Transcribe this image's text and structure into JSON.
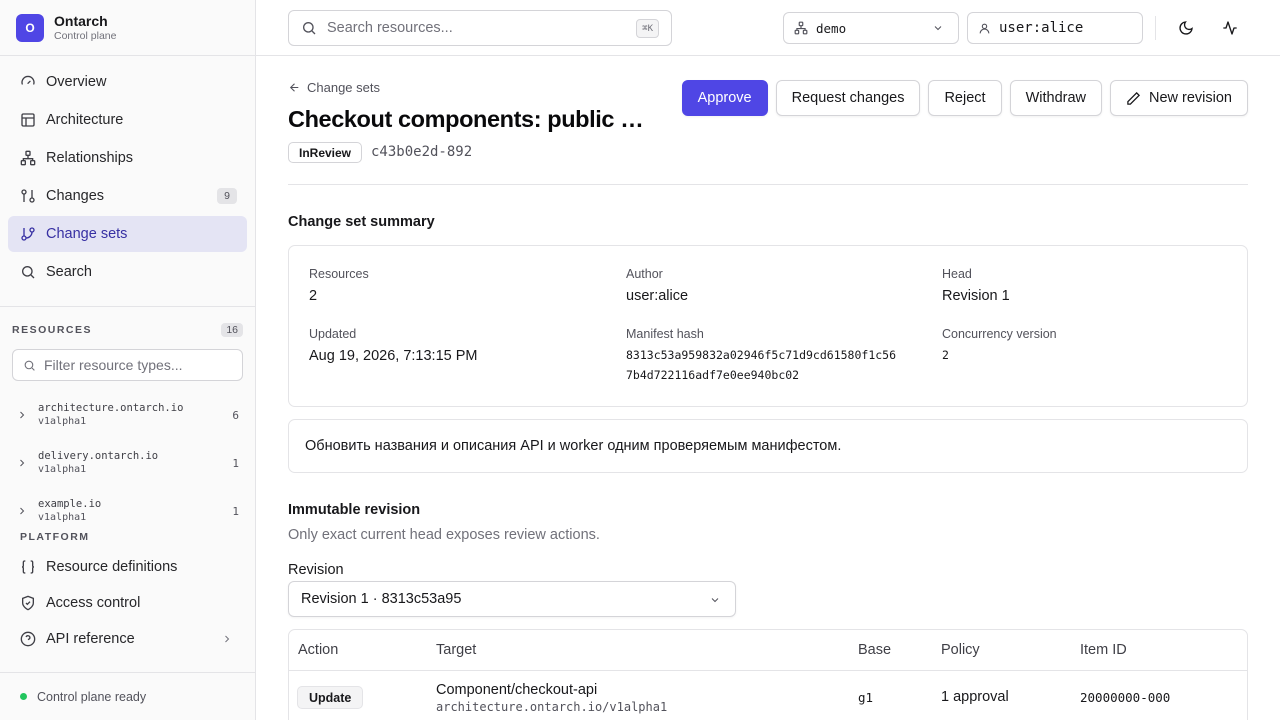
{
  "brand": {
    "logo_letter": "O",
    "name": "Ontarch",
    "subtitle": "Control plane"
  },
  "nav": [
    {
      "label": "Overview",
      "icon": "gauge-icon"
    },
    {
      "label": "Architecture",
      "icon": "layout-icon"
    },
    {
      "label": "Relationships",
      "icon": "network-icon"
    },
    {
      "label": "Changes",
      "icon": "git-compare-icon",
      "badge": "9"
    },
    {
      "label": "Change sets",
      "icon": "git-branch-icon",
      "active": true
    },
    {
      "label": "Search",
      "icon": "search-icon"
    }
  ],
  "resources": {
    "label": "RESOURCES",
    "count": "16",
    "filter_placeholder": "Filter resource types...",
    "groups": [
      {
        "group": "architecture.ontarch.io",
        "version": "v1alpha1",
        "count": "6"
      },
      {
        "group": "delivery.ontarch.io",
        "version": "v1alpha1",
        "count": "1"
      },
      {
        "group": "example.io",
        "version": "v1alpha1",
        "count": "1"
      }
    ]
  },
  "platform": {
    "label": "PLATFORM",
    "items": [
      {
        "label": "Resource definitions",
        "icon": "braces-icon"
      },
      {
        "label": "Access control",
        "icon": "shield-icon"
      },
      {
        "label": "API reference",
        "icon": "help-circle-icon"
      }
    ]
  },
  "status": {
    "text": "Control plane ready",
    "color": "#22c55e"
  },
  "topbar": {
    "search_placeholder": "Search resources...",
    "shortcut": "⌘K",
    "workspace": "demo",
    "user": "user:alice"
  },
  "page": {
    "back_label": "Change sets",
    "title": "Checkout components: public names and descriptions",
    "status": "InReview",
    "id": "c43b0e2d-892",
    "actions": {
      "approve": "Approve",
      "request_changes": "Request changes",
      "reject": "Reject",
      "withdraw": "Withdraw",
      "new_revision": "New revision"
    }
  },
  "summary": {
    "heading": "Change set summary",
    "resources_label": "Resources",
    "resources": "2",
    "author_label": "Author",
    "author": "user:alice",
    "head_label": "Head",
    "head": "Revision 1",
    "updated_label": "Updated",
    "updated": "Aug 19, 2026, 7:13:15 PM",
    "hash_label": "Manifest hash",
    "hash_line1": "8313c53a959832a02946f5c71d9cd61580f1c56",
    "hash_line2": "7b4d722116adf7e0ee940bc02",
    "concurrency_label": "Concurrency version",
    "concurrency": "2",
    "description": "Обновить названия и описания API и worker одним проверяемым манифестом."
  },
  "revision": {
    "heading": "Immutable revision",
    "subtext": "Only exact current head exposes review actions.",
    "field_label": "Revision",
    "selected": "Revision 1 · 8313c53a95"
  },
  "table": {
    "headers": [
      "Action",
      "Target",
      "Base",
      "Policy",
      "Item ID"
    ],
    "rows": [
      {
        "action": "Update",
        "target": "Component/checkout-api",
        "target_sub": "architecture.ontarch.io/v1alpha1",
        "base": "g1",
        "policy": "1 approval",
        "item_id": "20000000-000"
      }
    ]
  },
  "colors": {
    "accent": "#4f46e5",
    "active_nav_bg": "#e4e4f4"
  }
}
